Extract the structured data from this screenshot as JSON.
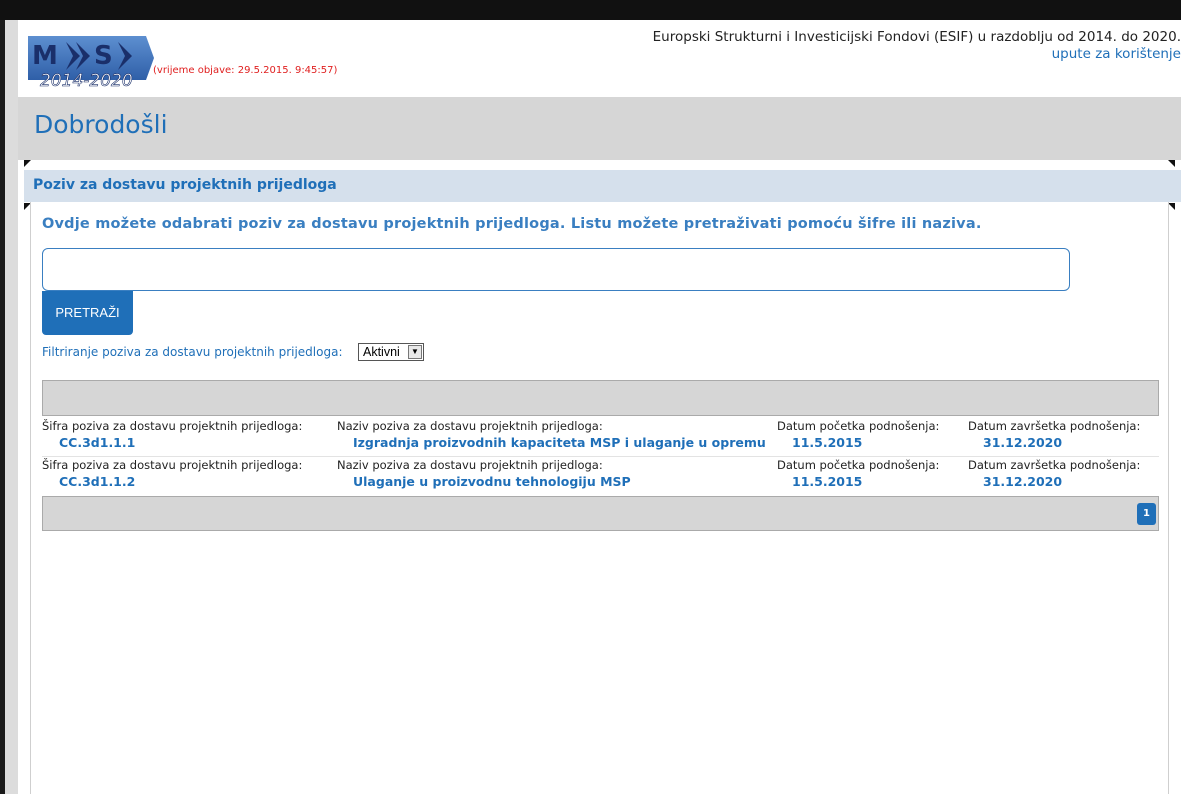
{
  "header": {
    "logo_text": "MIS 2014-2020",
    "published": "(vrijeme objave: 29.5.2015. 9:45:57)",
    "title": "Europski Strukturni i Investicijski Fondovi (ESIF) u razdoblju od 2014. do 2020.",
    "help_link": "upute za korištenje"
  },
  "welcome": {
    "title": "Dobrodošli"
  },
  "section": {
    "title": "Poziv za dostavu projektnih prijedloga"
  },
  "intro": "Ovdje možete odabrati poziv za dostavu projektnih prijedloga. Listu možete pretraživati pomoću šifre ili naziva.",
  "search": {
    "value": "",
    "button_label": "PRETRAŽI"
  },
  "filter": {
    "label": "Filtriranje poziva za dostavu projektnih prijedloga:",
    "selected": "Aktivni"
  },
  "table": {
    "rows": [
      {
        "code_label": "Šifra poziva za dostavu projektnih prijedloga:",
        "code": "CC.3d1.1.1",
        "name_label": "Naziv poziva za dostavu projektnih prijedloga:",
        "name": "Izgradnja proizvodnih kapaciteta MSP i ulaganje u opremu",
        "start_label": "Datum početka podnošenja:",
        "start": "11.5.2015",
        "end_label": "Datum završetka podnošenja:",
        "end": "31.12.2020"
      },
      {
        "code_label": "Šifra poziva za dostavu projektnih prijedloga:",
        "code": "CC.3d1.1.2",
        "name_label": "Naziv poziva za dostavu projektnih prijedloga:",
        "name": "Ulaganje u proizvodnu tehnologiju MSP",
        "start_label": "Datum početka podnošenja:",
        "start": "11.5.2015",
        "end_label": "Datum završetka podnošenja:",
        "end": "31.12.2020"
      }
    ],
    "pagination": {
      "current_page": "1"
    }
  },
  "colors": {
    "accent": "#1f6fb8",
    "published": "#e02020",
    "band": "#d6d6d6",
    "section": "#d5e0ec"
  }
}
